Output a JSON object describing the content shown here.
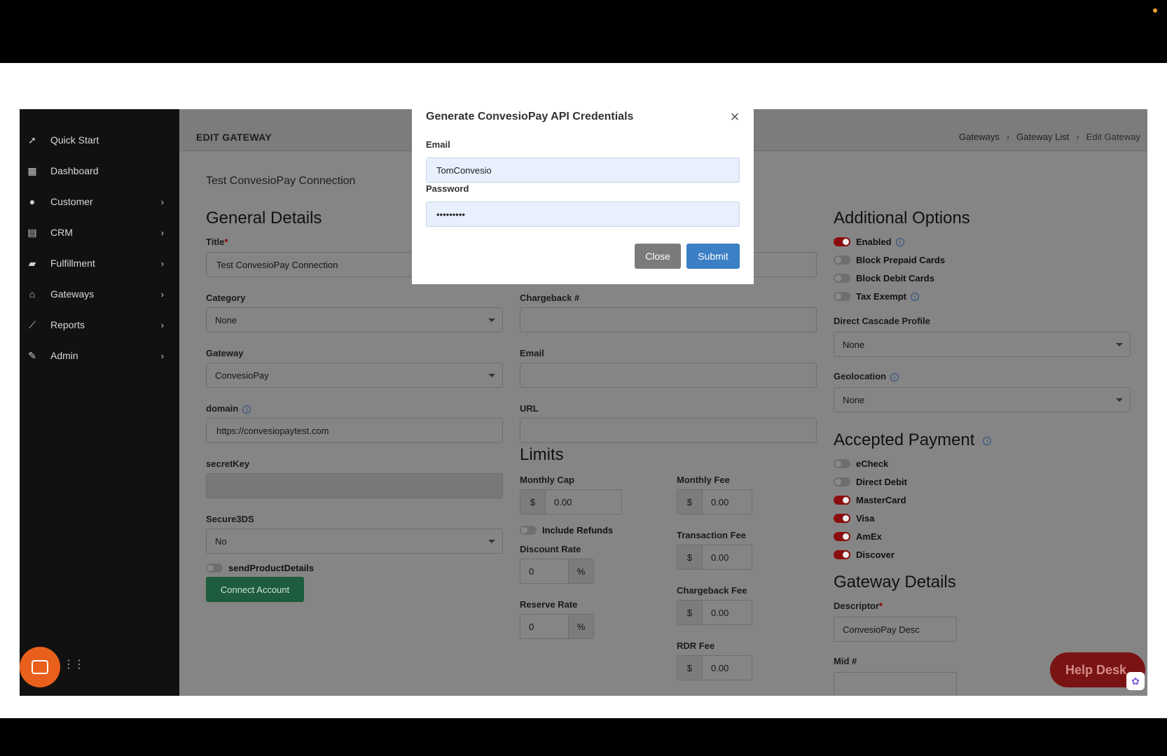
{
  "modal": {
    "title": "Generate ConvesioPay API Credentials",
    "email_label": "Email",
    "email_value": "TomConvesio",
    "password_label": "Password",
    "password_value": "•••••••••",
    "close_label": "Close",
    "submit_label": "Submit"
  },
  "sidebar": {
    "items": [
      {
        "label": "Quick Start",
        "icon": "rocket-icon",
        "has_chevron": false
      },
      {
        "label": "Dashboard",
        "icon": "dashboard-icon",
        "has_chevron": false
      },
      {
        "label": "Customer",
        "icon": "user-icon",
        "has_chevron": true
      },
      {
        "label": "CRM",
        "icon": "table-icon",
        "has_chevron": true
      },
      {
        "label": "Fulfillment",
        "icon": "truck-icon",
        "has_chevron": true
      },
      {
        "label": "Gateways",
        "icon": "bank-icon",
        "has_chevron": true
      },
      {
        "label": "Reports",
        "icon": "chart-icon",
        "has_chevron": true
      },
      {
        "label": "Admin",
        "icon": "wrench-icon",
        "has_chevron": true
      }
    ]
  },
  "header": {
    "title": "EDIT GATEWAY",
    "breadcrumbs": [
      "Gateways",
      "Gateway List",
      "Edit Gateway"
    ]
  },
  "card_title": "Test ConvesioPay Connection",
  "general": {
    "section_title": "General Details",
    "title_label": "Title",
    "title_value": "Test ConvesioPay Connection",
    "category_label": "Category",
    "category_value": "None",
    "gateway_label": "Gateway",
    "gateway_value": "ConvesioPay",
    "domain_label": "domain",
    "domain_value": "https://convesiopaytest.com",
    "secret_label": "secretKey",
    "secret_value": "",
    "secure3ds_label": "Secure3DS",
    "secure3ds_value": "No",
    "send_product_label": "sendProductDetails",
    "connect_label": "Connect Account"
  },
  "middle": {
    "chargeback_label": "Chargeback #",
    "email_label": "Email",
    "url_label": "URL"
  },
  "limits": {
    "section_title": "Limits",
    "monthly_cap_label": "Monthly Cap",
    "monthly_cap_value": "0.00",
    "include_refunds_label": "Include Refunds",
    "discount_rate_label": "Discount Rate",
    "discount_rate_value": "0",
    "reserve_rate_label": "Reserve Rate",
    "reserve_rate_value": "0",
    "monthly_fee_label": "Monthly Fee",
    "monthly_fee_value": "0.00",
    "transaction_fee_label": "Transaction Fee",
    "transaction_fee_value": "0.00",
    "chargeback_fee_label": "Chargeback Fee",
    "chargeback_fee_value": "0.00",
    "rdr_fee_label": "RDR Fee",
    "rdr_fee_value": "0.00",
    "currency_symbol": "$",
    "percent_symbol": "%"
  },
  "additional": {
    "section_title": "Additional Options",
    "enabled_label": "Enabled",
    "enabled_on": true,
    "block_prepaid_label": "Block Prepaid Cards",
    "block_prepaid_on": false,
    "block_debit_label": "Block Debit Cards",
    "block_debit_on": false,
    "tax_exempt_label": "Tax Exempt",
    "tax_exempt_on": false,
    "cascade_label": "Direct Cascade Profile",
    "cascade_value": "None",
    "geolocation_label": "Geolocation",
    "geolocation_value": "None"
  },
  "accepted": {
    "section_title": "Accepted Payment",
    "echeck_label": "eCheck",
    "echeck_on": false,
    "direct_debit_label": "Direct Debit",
    "direct_debit_on": false,
    "mastercard_label": "MasterCard",
    "mastercard_on": true,
    "visa_label": "Visa",
    "visa_on": true,
    "amex_label": "AmEx",
    "amex_on": true,
    "discover_label": "Discover",
    "discover_on": true
  },
  "gateway_details": {
    "section_title": "Gateway Details",
    "descriptor_label": "Descriptor",
    "descriptor_value": "ConvesioPay Desc",
    "mid_label": "Mid #"
  },
  "help_desk_label": "Help Desk",
  "colors": {
    "toggle_on": "#8b0d0d",
    "submit_blue": "#3b7fc4",
    "connect_green": "#1d5c3c",
    "chat_orange": "#e8601c"
  }
}
